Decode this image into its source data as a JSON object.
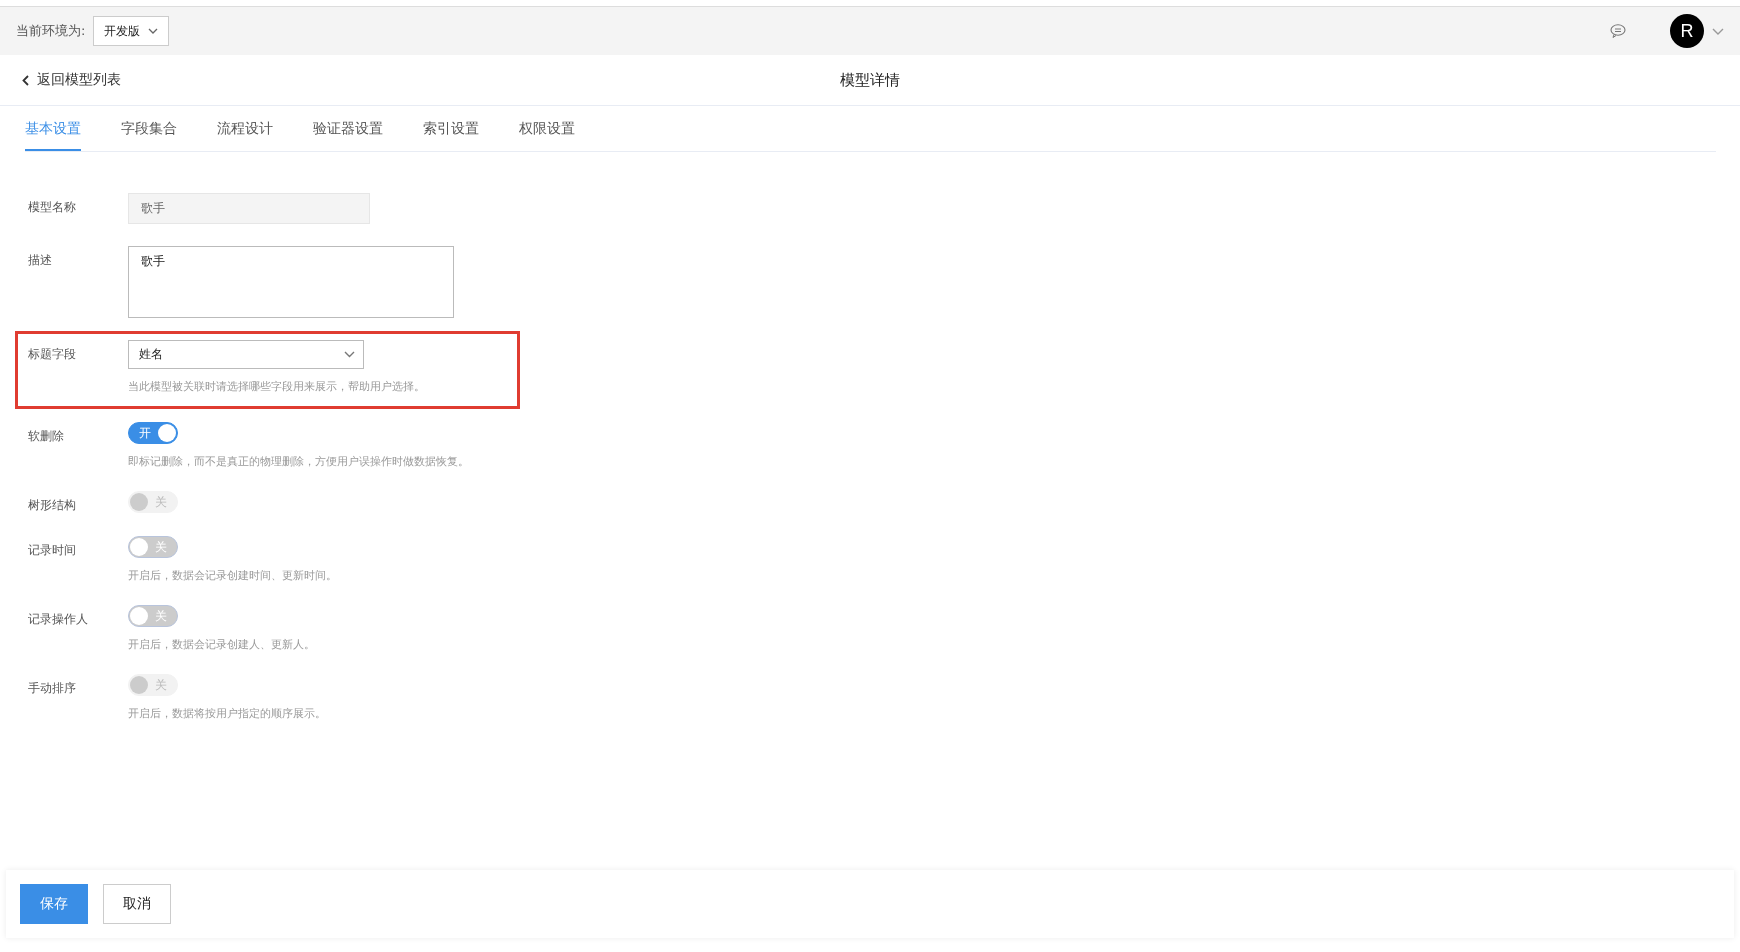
{
  "topbar": {
    "env_label": "当前环境为:",
    "env_value": "开发版",
    "avatar_letter": "R"
  },
  "header": {
    "back": "返回模型列表",
    "title": "模型详情"
  },
  "tabs": [
    {
      "label": "基本设置",
      "selected": true
    },
    {
      "label": "字段集合",
      "selected": false
    },
    {
      "label": "流程设计",
      "selected": false
    },
    {
      "label": "验证器设置",
      "selected": false
    },
    {
      "label": "索引设置",
      "selected": false
    },
    {
      "label": "权限设置",
      "selected": false
    }
  ],
  "form": [
    {
      "kind": "input",
      "label": "模型名称",
      "value": "歌手",
      "disabled": true,
      "highlighted": false
    },
    {
      "kind": "textarea",
      "label": "描述",
      "value": "歌手",
      "highlighted": false
    },
    {
      "kind": "select",
      "label": "标题字段",
      "value": "姓名",
      "hint": "当此模型被关联时请选择哪些字段用来展示，帮助用户选择。",
      "highlighted": true
    },
    {
      "kind": "toggle",
      "label": "软删除",
      "on": true,
      "disabled": false,
      "text": "开",
      "hint": "即标记删除，而不是真正的物理删除，方便用户误操作时做数据恢复。",
      "highlighted": false
    },
    {
      "kind": "toggle",
      "label": "树形结构",
      "on": false,
      "disabled": true,
      "text": "关",
      "highlighted": false
    },
    {
      "kind": "toggle",
      "label": "记录时间",
      "on": false,
      "disabled": false,
      "text": "关",
      "hint": "开启后，数据会记录创建时间、更新时间。",
      "highlighted": false
    },
    {
      "kind": "toggle",
      "label": "记录操作人",
      "on": false,
      "disabled": false,
      "text": "关",
      "hint": "开启后，数据会记录创建人、更新人。",
      "highlighted": false
    },
    {
      "kind": "toggle",
      "label": "手动排序",
      "on": false,
      "disabled": true,
      "text": "关",
      "hint": "开启后，数据将按用户指定的顺序展示。",
      "highlighted": false
    }
  ],
  "footer": {
    "buttons": [
      "保存",
      "取消"
    ]
  }
}
